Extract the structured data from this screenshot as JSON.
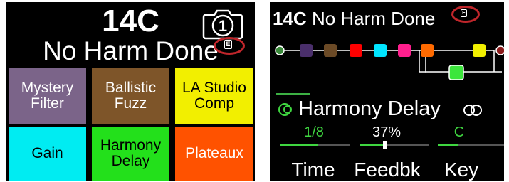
{
  "left": {
    "preset_number": "14C",
    "preset_name": "No Harm Done",
    "snapshot_number": "1",
    "snapshot_badge": "E",
    "footswitches": [
      {
        "line1": "Mystery",
        "line2": "Filter",
        "color": "#7b6489"
      },
      {
        "line1": "Ballistic",
        "line2": "Fuzz",
        "color": "#7e5529"
      },
      {
        "line1": "LA Studio",
        "line2": "Comp",
        "color": "#f2ef00"
      },
      {
        "line1": "Gain",
        "line2": "",
        "color": "#00ecf2"
      },
      {
        "line1": "Harmony",
        "line2": "Delay",
        "color": "#23e01b"
      },
      {
        "line1": "Plateaux",
        "line2": "",
        "color": "#ff5200"
      }
    ],
    "highlight_color": "#c0262b"
  },
  "right": {
    "preset_number": "14C",
    "preset_name": "No Harm Done",
    "snapshot_badge": "E",
    "signal_chain": {
      "blocks": [
        "#4a2f6b",
        "#6b4a26",
        "#ff0000",
        "#00e5ff",
        "#ff1f8e",
        "#ff6a00",
        "#f2ef00",
        "#3ce63c"
      ],
      "input_color": "#3a8a3a",
      "output_color": "#8b1a1a"
    },
    "selected_block": {
      "name": "Harmony Delay",
      "icon": "delay-rings-icon",
      "stereo_icon": "stereo-link-icon"
    },
    "params": [
      {
        "label": "Time",
        "value": "1/8",
        "level": 0.55
      },
      {
        "label": "Feedbk",
        "value": "37%",
        "level": 0.37
      },
      {
        "label": "Key",
        "value": "C",
        "level": 0.3
      }
    ]
  }
}
